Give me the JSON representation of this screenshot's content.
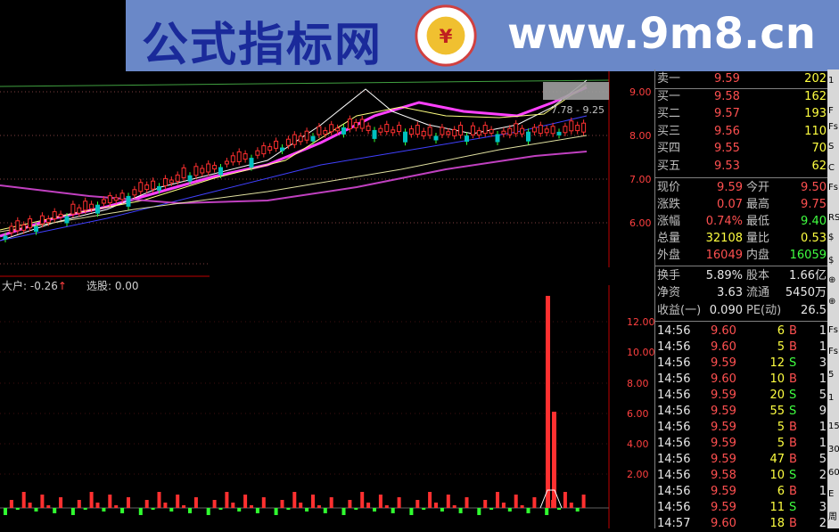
{
  "banner": {
    "title": "公式指标网",
    "url": "www.9m8.cn",
    "logo_ring_text": "www.9m8.cn"
  },
  "price_axis": [
    "9.00",
    "8.00",
    "7.00",
    "6.00"
  ],
  "ma_label": "7.78 - 9.25",
  "indicator": {
    "label": "大户: -0.26",
    "arrow": "↑",
    "select_label": "选股: 0.00",
    "axis": [
      "12.00",
      "10.00",
      "8.00",
      "6.00",
      "4.00",
      "2.00"
    ]
  },
  "order_book": [
    {
      "label": "卖一",
      "price": "9.59",
      "vol": "202"
    },
    {
      "label": "买一",
      "price": "9.58",
      "vol": "162"
    },
    {
      "label": "买二",
      "price": "9.57",
      "vol": "193"
    },
    {
      "label": "买三",
      "price": "9.56",
      "vol": "110"
    },
    {
      "label": "买四",
      "price": "9.55",
      "vol": "70"
    },
    {
      "label": "买五",
      "price": "9.53",
      "vol": "62"
    }
  ],
  "stats": [
    {
      "l1": "现价",
      "v1": "9.59",
      "c1": "red",
      "l2": "今开",
      "v2": "9.50",
      "c2": "red"
    },
    {
      "l1": "涨跌",
      "v1": "0.07",
      "c1": "red",
      "l2": "最高",
      "v2": "9.75",
      "c2": "red"
    },
    {
      "l1": "涨幅",
      "v1": "0.74%",
      "c1": "red",
      "l2": "最低",
      "v2": "9.40",
      "c2": "green"
    },
    {
      "l1": "总量",
      "v1": "32108",
      "c1": "yel",
      "l2": "量比",
      "v2": "0.53",
      "c2": "yel"
    },
    {
      "l1": "外盘",
      "v1": "16049",
      "c1": "red",
      "l2": "内盘",
      "v2": "16059",
      "c2": "green"
    }
  ],
  "finance": [
    {
      "l1": "换手",
      "v1": "5.89%",
      "l2": "股本",
      "v2": "1.66亿"
    },
    {
      "l1": "净资",
      "v1": "3.63",
      "l2": "流通",
      "v2": "5450万"
    },
    {
      "l1": "收益(一)",
      "v1": "0.090",
      "l2": "PE(动)",
      "v2": "26.5"
    }
  ],
  "ticks": [
    {
      "time": "14:56",
      "price": "9.60",
      "vol": "6",
      "side": "B",
      "n": "1"
    },
    {
      "time": "14:56",
      "price": "9.60",
      "vol": "5",
      "side": "B",
      "n": "1"
    },
    {
      "time": "14:56",
      "price": "9.59",
      "vol": "12",
      "side": "S",
      "n": "3"
    },
    {
      "time": "14:56",
      "price": "9.60",
      "vol": "10",
      "side": "B",
      "n": "1"
    },
    {
      "time": "14:56",
      "price": "9.59",
      "vol": "20",
      "side": "S",
      "n": "5"
    },
    {
      "time": "14:56",
      "price": "9.59",
      "vol": "55",
      "side": "S",
      "n": "9"
    },
    {
      "time": "14:56",
      "price": "9.59",
      "vol": "5",
      "side": "B",
      "n": "1"
    },
    {
      "time": "14:56",
      "price": "9.59",
      "vol": "5",
      "side": "B",
      "n": "1"
    },
    {
      "time": "14:56",
      "price": "9.59",
      "vol": "47",
      "side": "B",
      "n": "5"
    },
    {
      "time": "14:56",
      "price": "9.58",
      "vol": "10",
      "side": "S",
      "n": "2"
    },
    {
      "time": "14:56",
      "price": "9.59",
      "vol": "6",
      "side": "B",
      "n": "1"
    },
    {
      "time": "14:56",
      "price": "9.59",
      "vol": "11",
      "side": "S",
      "n": "3"
    },
    {
      "time": "14:57",
      "price": "9.60",
      "vol": "18",
      "side": "B",
      "n": "2"
    }
  ],
  "right_strip": [
    "1",
    "F",
    "Fs",
    "S",
    "C",
    "Fs",
    "RS",
    "$",
    "$",
    "⊕",
    "⊕",
    "Fs",
    "Fs",
    "5",
    "1",
    "15",
    "30",
    "60",
    "E",
    "周"
  ],
  "colors": {
    "up": "#ff3030",
    "down": "#30ff30",
    "ma_magenta": "#ff40ff",
    "ma_yellow": "#ffff80",
    "ma_white": "#ffffff",
    "ma_blue": "#4040ff",
    "ma_purple": "#c040c0",
    "axis_red": "#c00000"
  }
}
